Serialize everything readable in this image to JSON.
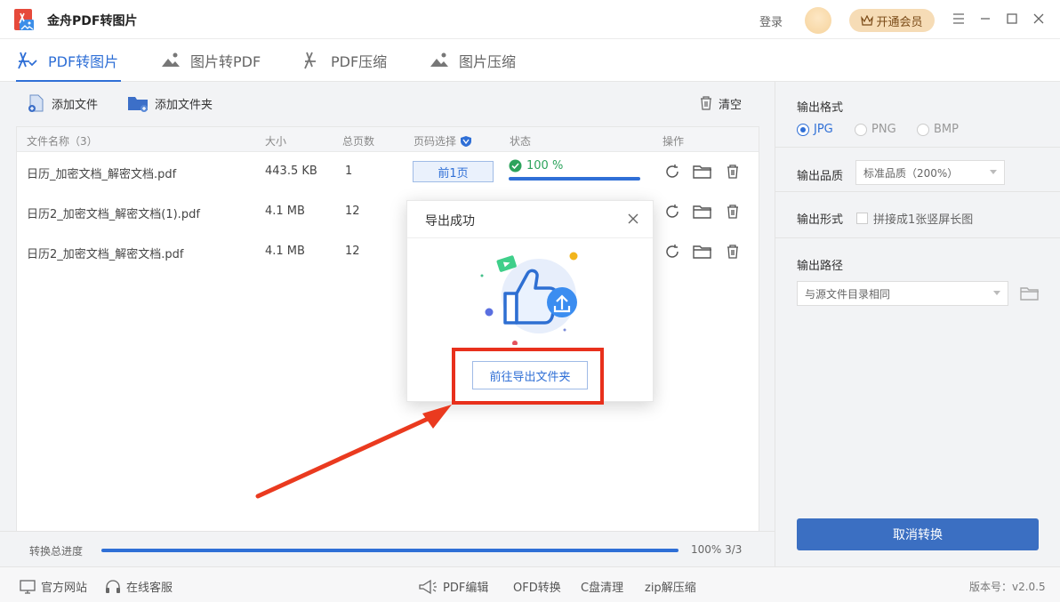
{
  "app": {
    "title": "金舟PDF转图片",
    "login_label": "登录",
    "vip_label": "开通会员"
  },
  "tabs": [
    {
      "label": "PDF转图片",
      "active": true
    },
    {
      "label": "图片转PDF",
      "active": false
    },
    {
      "label": "PDF压缩",
      "active": false
    },
    {
      "label": "图片压缩",
      "active": false
    }
  ],
  "toolbar": {
    "add_file": "添加文件",
    "add_folder": "添加文件夹",
    "clear": "清空"
  },
  "table": {
    "headers": {
      "name": "文件名称（3）",
      "size": "大小",
      "pages": "总页数",
      "page_select": "页码选择",
      "status": "状态",
      "actions": "操作"
    },
    "rows": [
      {
        "name": "日历_加密文档_解密文档.pdf",
        "size": "443.5 KB",
        "pages": "1",
        "page_select": "前1页",
        "status": "100 %"
      },
      {
        "name": "日历2_加密文档_解密文档(1).pdf",
        "size": "4.1 MB",
        "pages": "12"
      },
      {
        "name": "日历2_加密文档_解密文档.pdf",
        "size": "4.1 MB",
        "pages": "12"
      }
    ]
  },
  "progress": {
    "label": "转换总进度",
    "text": "100% 3/3",
    "fraction": 1.0
  },
  "settings": {
    "format_label": "输出格式",
    "formats": [
      "JPG",
      "PNG",
      "BMP"
    ],
    "selected_format": "JPG",
    "quality_label": "输出品质",
    "quality_value": "标准品质（200%）",
    "form_label": "输出形式",
    "form_checkbox": "拼接成1张竖屏长图",
    "path_label": "输出路径",
    "path_value": "与源文件目录相同",
    "cancel_button": "取消转换"
  },
  "bottombar": {
    "website": "官方网站",
    "service": "在线客服",
    "links": [
      "PDF编辑",
      "OFD转换",
      "C盘清理",
      "zip解压缩"
    ],
    "version": "版本号：v2.0.5"
  },
  "dialog": {
    "title": "导出成功",
    "open_folder_button": "前往导出文件夹"
  },
  "colors": {
    "accent": "#2f6fd6",
    "success": "#2ca35c",
    "highlight": "#e8301c",
    "cancel_button": "#3b6fc2"
  }
}
